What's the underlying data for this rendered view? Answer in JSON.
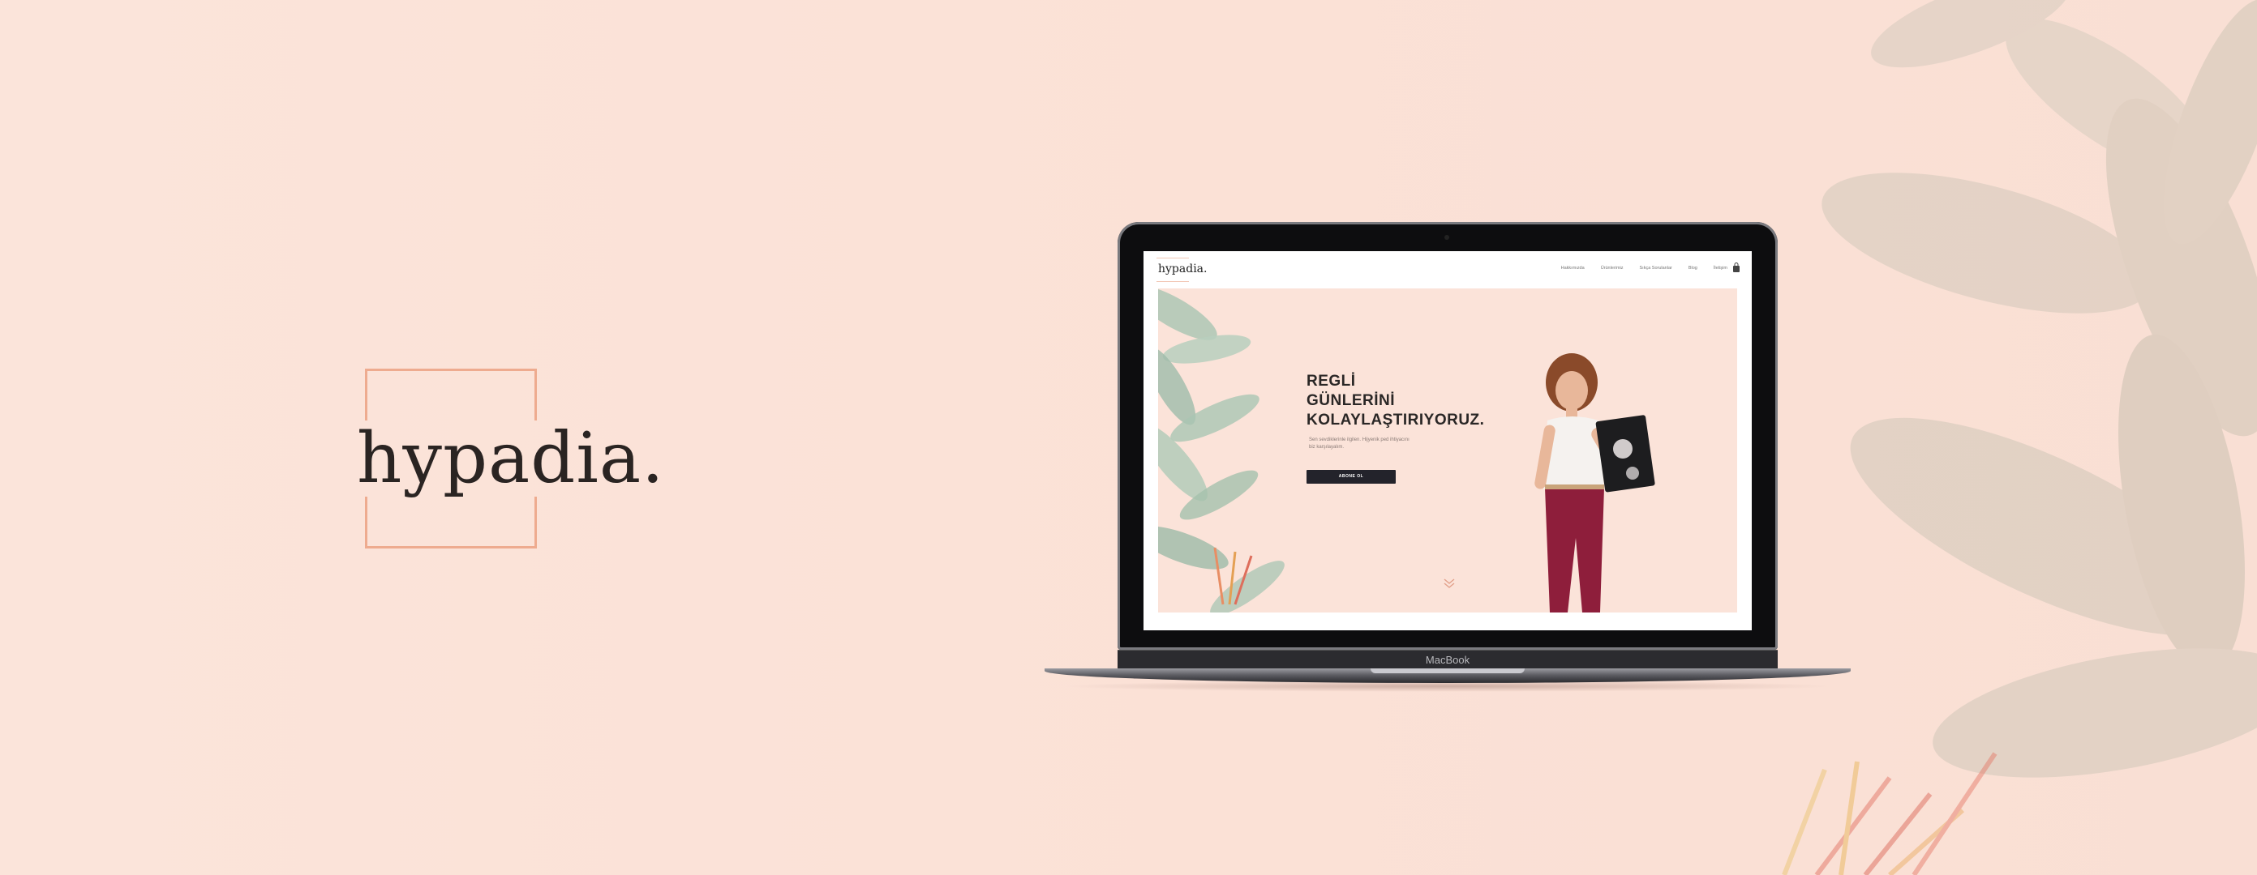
{
  "brand": {
    "logo_text": "hypadia."
  },
  "colors": {
    "background": "#fbe3d9",
    "accent": "#eeab8f",
    "dark": "#2a2422"
  },
  "laptop": {
    "model_label": "MacBook"
  },
  "site": {
    "logo_text": "hypadia.",
    "nav": [
      {
        "label": "Hakkımızda"
      },
      {
        "label": "Ürünlerimiz"
      },
      {
        "label": "Sıkça Sorulanlar"
      },
      {
        "label": "Blog"
      },
      {
        "label": "İletişim"
      }
    ],
    "cart_icon": "shopping-bag-icon",
    "hero": {
      "title_lines": [
        "REGLİ",
        "GÜNLERİNİ",
        "KOLAYLAŞTIRIYORUZ."
      ],
      "subtitle": "Sen sevdiklerinle ilgilen. Hijyenik ped ihtiyacını biz karşılayalım.",
      "button_label": "ABONE OL",
      "scroll_icon": "double-chevron-down-icon"
    }
  }
}
